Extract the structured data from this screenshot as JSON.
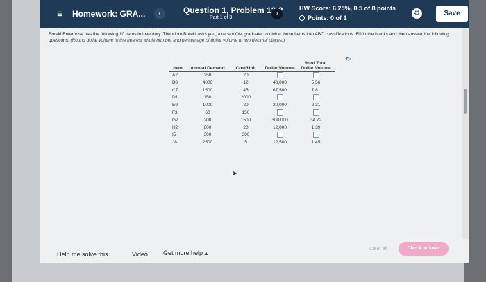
{
  "header": {
    "menu_icon": "hamburger-menu-icon",
    "hw_title": "Homework: GRA...",
    "back_glyph": "‹",
    "question_title": "Question 1, Problem 12.2",
    "part": "Part 1 of 3",
    "forward_glyph": "›",
    "hw_score": "HW Score: 6.25%, 0.5 of 8 points",
    "points": "Points: 0 of 1",
    "save_label": "Save",
    "colors": {
      "bar": "#1f3a57"
    }
  },
  "problem": {
    "text": "Boreki Enterprise has the following 10 items in inventory. Theodore Boreki asks you, a recent OM graduate, to divide these items into ABC classifications. Fill in the blanks and then answer the following questions.",
    "note": "(Round dollar volume to the nearest whole number and percentage of dollar volume to two decimal places.)"
  },
  "table": {
    "headers": {
      "item": "Item",
      "demand": "Annual Demand",
      "cost": "Cost/Unit",
      "dollar_volume": "Dollar Volume",
      "percent": "% of Total Dollar Volume"
    },
    "rows": [
      {
        "item": "A2",
        "demand": "250",
        "cost": "20",
        "dollar": "",
        "percent": ""
      },
      {
        "item": "B8",
        "demand": "4000",
        "cost": "12",
        "dollar": "48,000",
        "percent": "5.56"
      },
      {
        "item": "C7",
        "demand": "1500",
        "cost": "45",
        "dollar": "67,500",
        "percent": "7.81"
      },
      {
        "item": "D1",
        "demand": "150",
        "cost": "2000",
        "dollar": "",
        "percent": ""
      },
      {
        "item": "E9",
        "demand": "1000",
        "cost": "20",
        "dollar": "20,000",
        "percent": "2.31"
      },
      {
        "item": "F3",
        "demand": "60",
        "cost": "150",
        "dollar": "",
        "percent": ""
      },
      {
        "item": "G2",
        "demand": "200",
        "cost": "1500",
        "dollar": "300,000",
        "percent": "34.72"
      },
      {
        "item": "H2",
        "demand": "600",
        "cost": "20",
        "dollar": "12,000",
        "percent": "1.39"
      },
      {
        "item": "I5",
        "demand": "300",
        "cost": "300",
        "dollar": "",
        "percent": ""
      },
      {
        "item": "J8",
        "demand": "2500",
        "cost": "5",
        "dollar": "12,500",
        "percent": "1.45"
      }
    ]
  },
  "footer": {
    "help": "Help me solve this",
    "video": "Video",
    "more_help": "Get more help ▴",
    "clear_all": "Clear all",
    "check_answer": "Check answer",
    "colors": {
      "check_button": "#f2a8c9"
    }
  }
}
